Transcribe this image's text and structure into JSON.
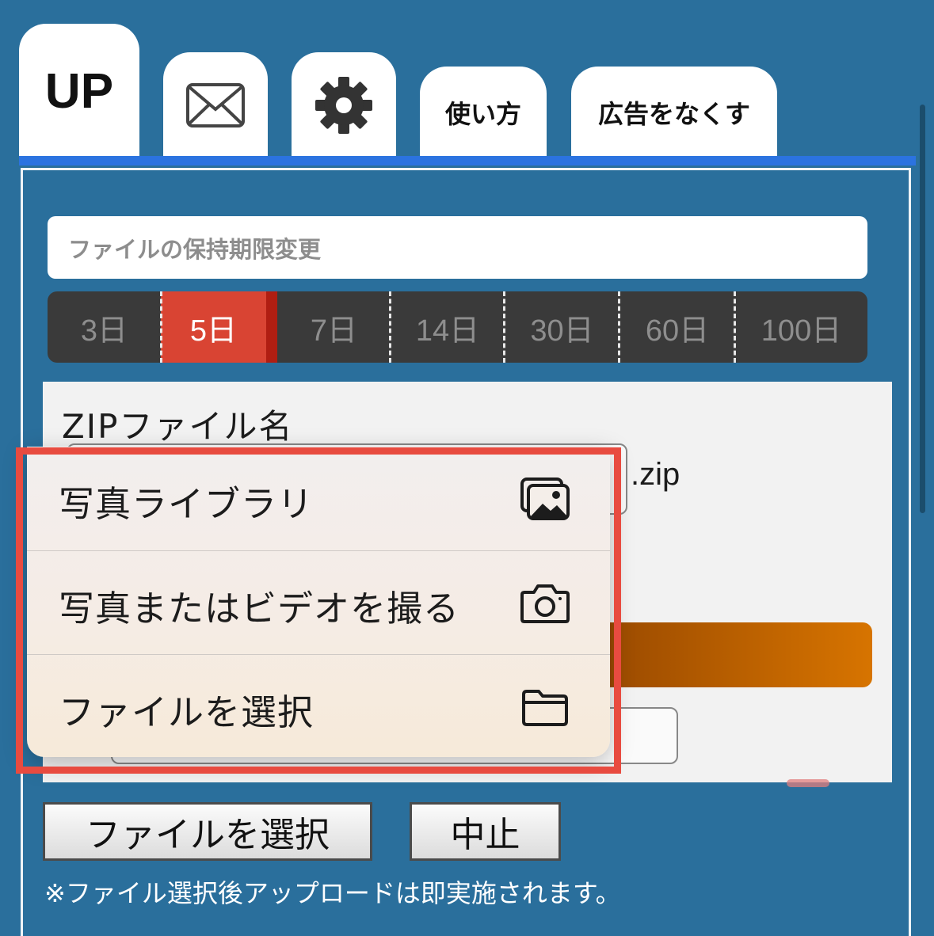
{
  "tabs": {
    "up": "UP",
    "mail_icon": "envelope-icon",
    "settings_icon": "gear-icon",
    "howto": "使い方",
    "noads": "広告をなくす"
  },
  "retention": {
    "header": "ファイルの保持期限変更",
    "options": [
      "3日",
      "5日",
      "7日",
      "14日",
      "30日",
      "60日",
      "100日"
    ],
    "selected": "5日"
  },
  "zip": {
    "label": "ZIPファイル名",
    "value": "",
    "ext": ".zip"
  },
  "action_menu": {
    "items": [
      {
        "label": "写真ライブラリ",
        "icon": "photo-library-icon"
      },
      {
        "label": "写真またはビデオを撮る",
        "icon": "camera-icon"
      },
      {
        "label": "ファイルを選択",
        "icon": "folder-icon"
      }
    ]
  },
  "buttons": {
    "select_file": "ファイルを選択",
    "cancel": "中止"
  },
  "note": "※ファイル選択後アップロードは即実施されます。",
  "colors": {
    "background": "#2a6f9c",
    "accent_blue": "#2b73e0",
    "selected_segment": "#d94433",
    "highlight_red": "#e84b40",
    "orange": "#d77400"
  }
}
